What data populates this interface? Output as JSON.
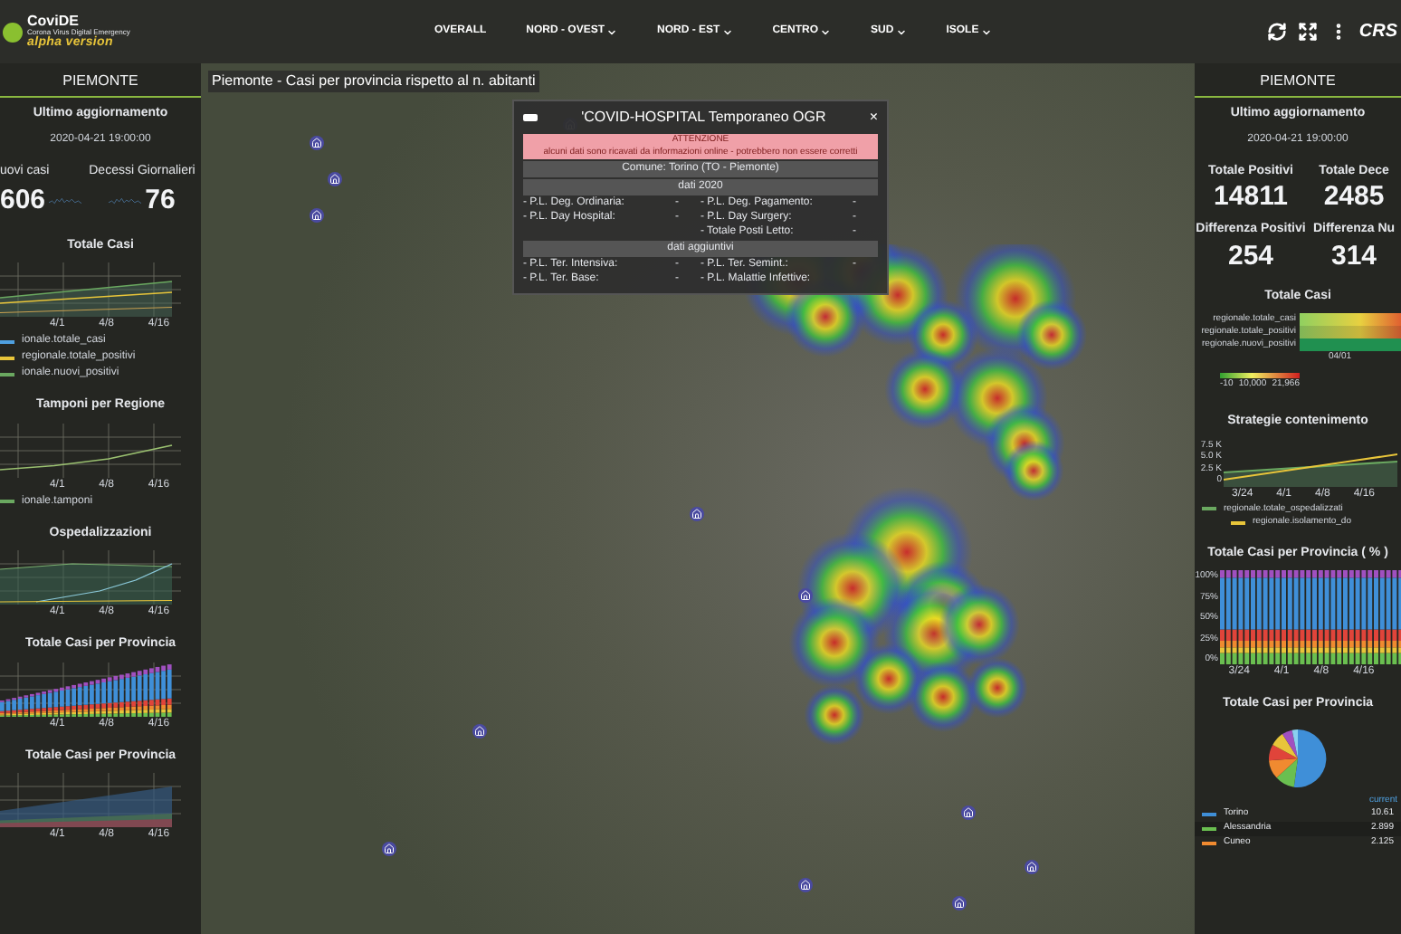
{
  "header": {
    "logo": {
      "name": "CoviDE",
      "subtitle": "Corona Virus Digital Emergency",
      "tag": "alpha version"
    },
    "nav": [
      {
        "label": "OVERALL",
        "dropdown": false
      },
      {
        "label": "NORD - OVEST",
        "dropdown": true
      },
      {
        "label": "NORD - EST",
        "dropdown": true
      },
      {
        "label": "CENTRO",
        "dropdown": true
      },
      {
        "label": "SUD",
        "dropdown": true
      },
      {
        "label": "ISOLE",
        "dropdown": true
      }
    ],
    "partner_logo": "CRS"
  },
  "left_panel": {
    "region": "PIEMONTE",
    "update_label": "Ultimo aggiornamento",
    "update_time": "2020-04-21 19:00:00",
    "stats": [
      {
        "label": "uovi casi",
        "value": "606"
      },
      {
        "label": "Decessi Giornalieri",
        "value": "76"
      }
    ],
    "charts": [
      {
        "kind": "lines",
        "title": "Totale Casi",
        "xticks": [
          "4/1",
          "4/8",
          "4/16"
        ],
        "legend": [
          {
            "label": "ionale.totale_casi",
            "color": "#4fa0e0"
          },
          {
            "label": "regionale.totale_positivi",
            "color": "#e8c53a"
          },
          {
            "label": "ionale.nuovi_positivi",
            "color": "#6aa860"
          }
        ]
      },
      {
        "kind": "single-line",
        "title": "Tamponi per Regione",
        "xticks": [
          "4/1",
          "4/8",
          "4/16"
        ],
        "legend": [
          {
            "label": "ionale.tamponi",
            "color": "#6aa860"
          }
        ]
      },
      {
        "kind": "areas",
        "title": "Ospedalizzazioni",
        "xticks": [
          "4/1",
          "4/8",
          "4/16"
        ]
      },
      {
        "kind": "stacked-bars",
        "title": "Totale Casi per Provincia",
        "xticks": [
          "4/1",
          "4/8",
          "4/16"
        ]
      },
      {
        "kind": "stacked-areas",
        "title": "Totale Casi per Provincia",
        "xticks": [
          "4/1",
          "4/8",
          "4/16"
        ]
      }
    ]
  },
  "map": {
    "title": "Piemonte - Casi per provincia rispetto al n. abitanti",
    "popup": {
      "title": "'COVID-HOSPITAL Temporaneo OGR",
      "close": "×",
      "warning_title": "ATTENZIONE",
      "warning_text": "alcuni dati sono ricavati da informazioni online - potrebbero non essere corretti",
      "comune": "Comune: Torino (TO - Piemonte)",
      "sections": [
        {
          "heading": "dati 2020",
          "rows": [
            [
              {
                "label": "- P.L. Deg. Ordinaria:",
                "value": "-"
              },
              {
                "label": "- P.L. Deg. Pagamento:",
                "value": "-"
              }
            ],
            [
              {
                "label": "- P.L. Day Hospital:",
                "value": "-"
              },
              {
                "label": "- P.L. Day Surgery:",
                "value": "-"
              }
            ],
            [
              null,
              {
                "label": "- Totale Posti Letto:",
                "value": "-"
              }
            ]
          ]
        },
        {
          "heading": "dati aggiuntivi",
          "rows": [
            [
              {
                "label": "- P.L. Ter. Intensiva:",
                "value": "-"
              },
              {
                "label": "- P.L. Ter. Semint.:",
                "value": "-"
              }
            ],
            [
              {
                "label": "- P.L. Ter. Base:",
                "value": "-"
              },
              {
                "label": "- P.L. Malattie Infettive:"
              }
            ]
          ]
        }
      ]
    }
  },
  "right_panel": {
    "region": "PIEMONTE",
    "update_label": "Ultimo aggiornamento",
    "update_time": "2020-04-21 19:00:00",
    "stats": [
      {
        "label": "Totale Positivi",
        "value": "14811"
      },
      {
        "label": "Totale Dece",
        "value": "2485"
      },
      {
        "label": "Differenza Positivi",
        "value": "254"
      },
      {
        "label": "Differenza Nu",
        "value": "314"
      }
    ],
    "heat_chart": {
      "title": "Totale Casi",
      "rows": [
        "regionale.totale_casi",
        "regionale.totale_positivi",
        "regionale.nuovi_positivi"
      ],
      "xtick": "04/01",
      "scale": [
        "-10",
        "10,000",
        "21,966"
      ]
    },
    "strategies": {
      "title": "Strategie contenimento",
      "yticks": [
        "7.5 K",
        "5.0 K",
        "2.5 K",
        "0"
      ],
      "xticks": [
        "3/24",
        "4/1",
        "4/8",
        "4/16"
      ],
      "legend": [
        {
          "label": "regionale.totale_ospedalizzati",
          "color": "#6aa860"
        },
        {
          "label": "regionale.isolamento_do",
          "color": "#e8c53a"
        }
      ]
    },
    "percent_chart": {
      "title": "Totale Casi per Provincia ( % )",
      "yticks": [
        "100%",
        "75%",
        "50%",
        "25%",
        "0%"
      ],
      "xticks": [
        "3/24",
        "4/1",
        "4/8",
        "4/16"
      ]
    },
    "pie": {
      "title": "Totale Casi per Provincia",
      "column": "current",
      "rows": [
        {
          "label": "Torino",
          "value": "10.61",
          "color": "#3f8fd8"
        },
        {
          "label": "Alessandria",
          "value": "2.899",
          "color": "#6abf50"
        },
        {
          "label": "Cuneo",
          "value": "2.125",
          "color": "#f08a30"
        }
      ]
    }
  }
}
